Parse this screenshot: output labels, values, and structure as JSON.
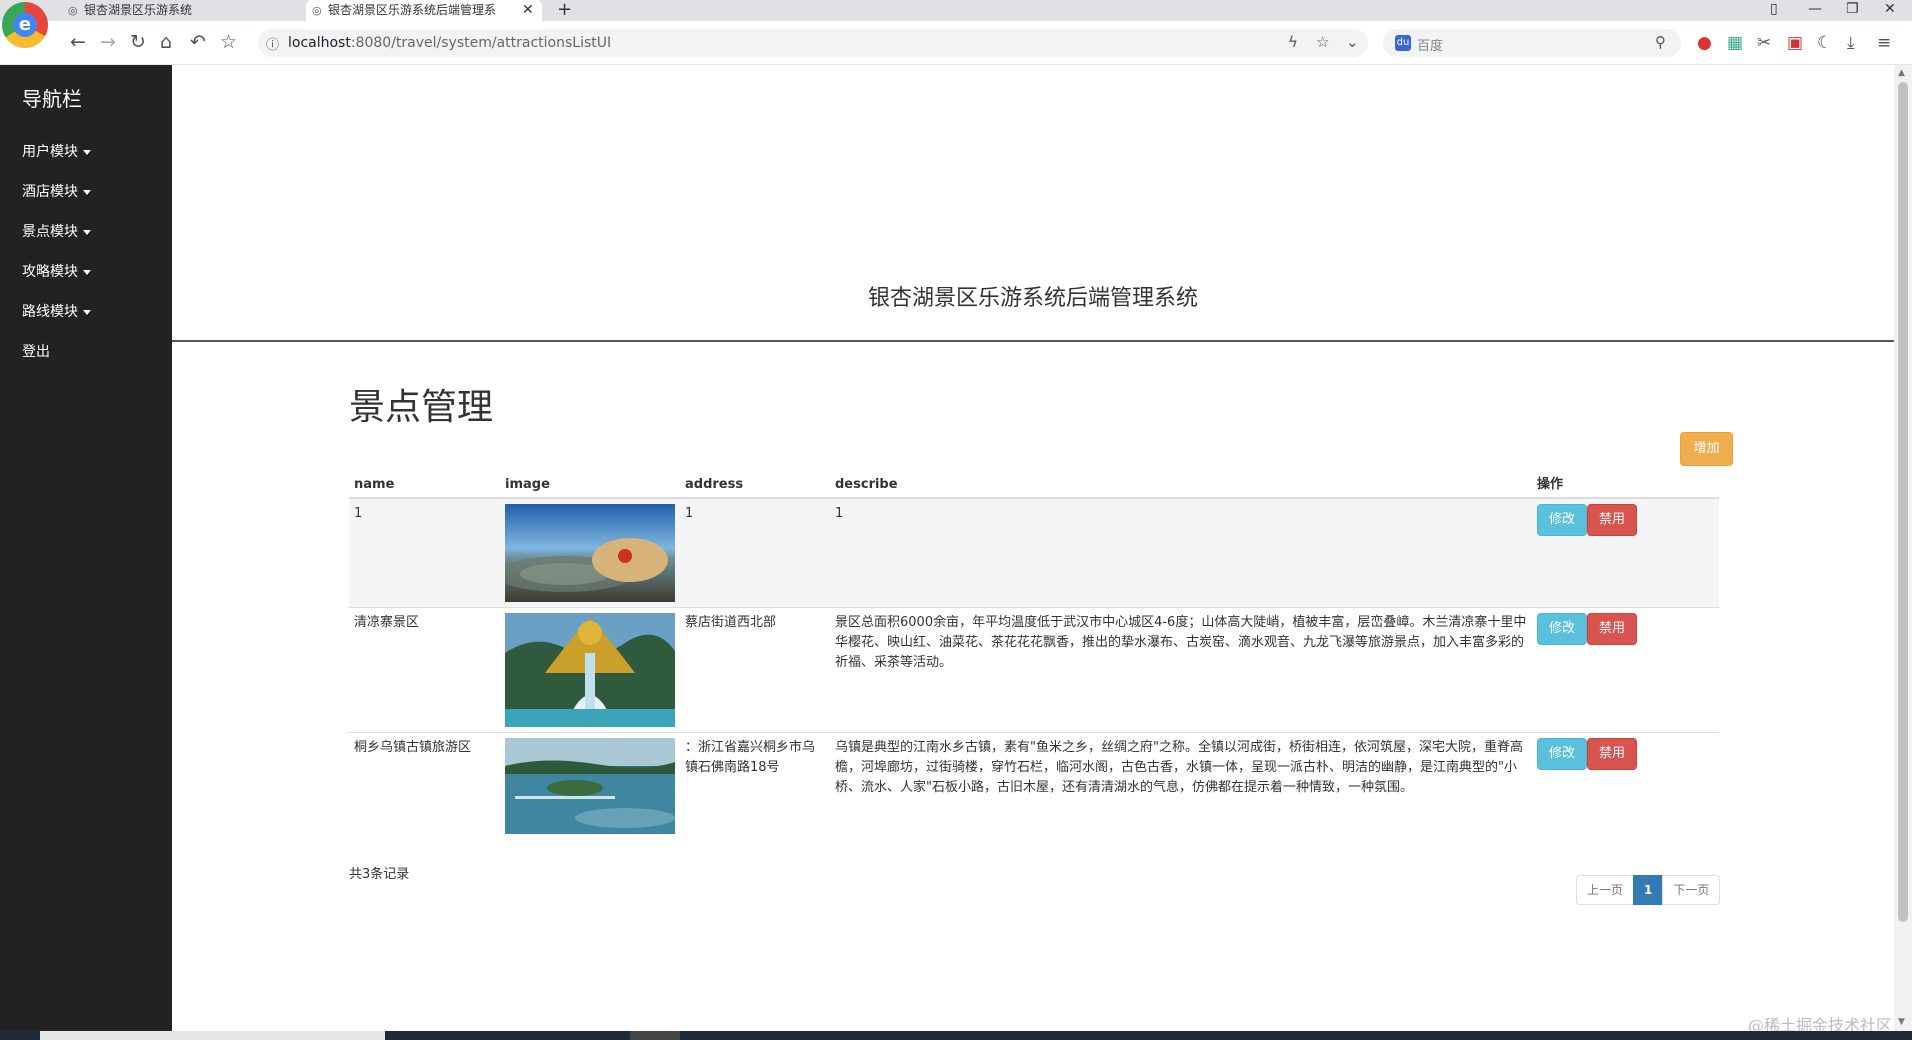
{
  "browser": {
    "tabs": [
      {
        "title": "银杏湖景区乐游系统",
        "active": false
      },
      {
        "title": "银杏湖景区乐游系统后端管理系",
        "active": true
      }
    ],
    "new_tab": "+",
    "url_host": "localhost",
    "url_path": ":8080/travel/system/attractionsListUI",
    "search_placeholder": "百度"
  },
  "sidebar": {
    "brand": "导航栏",
    "items": [
      {
        "label": "用户模块",
        "dropdown": true
      },
      {
        "label": "酒店模块",
        "dropdown": true
      },
      {
        "label": "景点模块",
        "dropdown": true
      },
      {
        "label": "攻略模块",
        "dropdown": true
      },
      {
        "label": "路线模块",
        "dropdown": true
      },
      {
        "label": "登出",
        "dropdown": false
      }
    ]
  },
  "main": {
    "system_title": "银杏湖景区乐游系统后端管理系统",
    "page_title": "景点管理",
    "add_label": "增加",
    "columns": [
      "name",
      "image",
      "address",
      "describe",
      "操作"
    ],
    "rows": [
      {
        "name": "1",
        "image": "sunset-lake-rock",
        "address": "1",
        "describe": "1"
      },
      {
        "name": "清凉寨景区",
        "image": "dragon-fountain",
        "address": "蔡店街道西北部",
        "describe": "景区总面积6000余亩，年平均温度低于武汉市中心城区4-6度；山体高大陡峭，植被丰富，层峦叠嶂。木兰清凉寨十里中华樱花、映山红、油菜花、茶花花花飘香，推出的挚水瀑布、古炭窑、滴水观音、九龙飞瀑等旅游景点，加入丰富多彩的祈福、采茶等活动。"
      },
      {
        "name": "桐乡乌镇古镇旅游区",
        "image": "lake-island",
        "address": "：浙江省嘉兴桐乡市乌镇石佛南路18号",
        "describe": "乌镇是典型的江南水乡古镇，素有\"鱼米之乡，丝绸之府\"之称。全镇以河成街，桥街相连，依河筑屋，深宅大院，重脊高檐，河埠廊坊，过街骑楼，穿竹石栏，临河水阁，古色古香，水镇一体，呈现一派古朴、明洁的幽静，是江南典型的\"小桥、流水、人家\"石板小路，古旧木屋，还有清清湖水的气息，仿佛都在提示着一种情致，一种氛围。"
      }
    ],
    "edit_label": "修改",
    "disable_label": "禁用",
    "total_text": "共3条记录",
    "pagination": {
      "prev": "上一页",
      "current": "1",
      "next": "下一页"
    }
  },
  "watermark": "@稀土掘金技术社区",
  "colors": {
    "sidebar_bg": "#222222",
    "add_btn": "#f0ad4e",
    "edit_btn": "#5bc0de",
    "disable_btn": "#d9534f",
    "pager_active": "#337ab7"
  }
}
